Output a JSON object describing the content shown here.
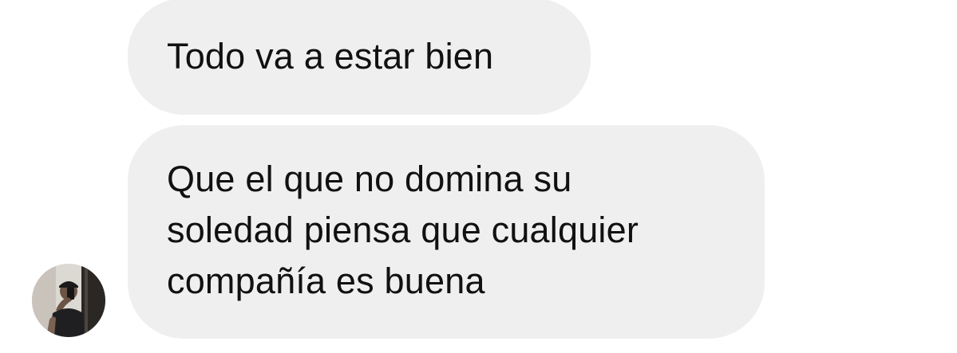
{
  "messages": [
    {
      "lines": [
        "Todo va a estar bien"
      ]
    },
    {
      "lines": [
        "Que el que no domina su",
        "soledad piensa que cualquier",
        "compañía es buena"
      ]
    }
  ],
  "avatar": {
    "icon": "user-avatar-photo"
  },
  "colors": {
    "bubble_bg": "#efefef",
    "text": "#111111",
    "page_bg": "#ffffff"
  }
}
